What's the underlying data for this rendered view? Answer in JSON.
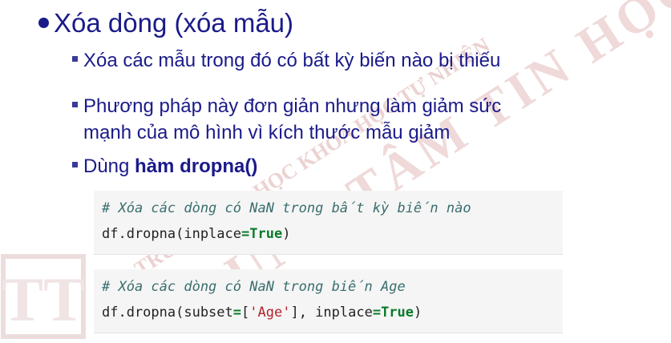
{
  "bullet_main": "Xóa dòng (xóa mẫu)",
  "sub_items": [
    {
      "text": "Xóa các mẫu trong đó có bất kỳ biến nào bị thiếu"
    },
    {
      "text": "Phương pháp này đơn giản nhưng làm giảm sức",
      "cont": "mạnh của mô hình vì kích thước mẫu giảm"
    },
    {
      "prefix": "Dùng ",
      "bold": "hàm dropna()"
    }
  ],
  "code_blocks": [
    {
      "comment": "# Xóa các dòng có NaN trong bất kỳ biến nào",
      "code": {
        "pre": "df.dropna(inplace",
        "eq": "=",
        "kw": "True",
        "post": ")"
      }
    },
    {
      "comment": "# Xóa các dòng có NaN trong biến Age",
      "code": {
        "pre": "df.dropna(subset",
        "eq": "=",
        "bracket_open": "[",
        "str": "'Age'",
        "bracket_close": "], inplace",
        "eq2": "=",
        "kw": "True",
        "post": ")"
      }
    }
  ],
  "watermark": {
    "line1": "TRƯỜNG ĐẠI HỌC KHOA HỌC TỰ NHIÊN",
    "line2": "TRUNG TÂM TIN HỌC",
    "logo": "TT"
  },
  "colors": {
    "text": "#1a1a8a",
    "comment": "#3a6e6e",
    "keyword": "#0a7a2a",
    "string": "#b2222a",
    "watermark": "#e9c9c9"
  }
}
